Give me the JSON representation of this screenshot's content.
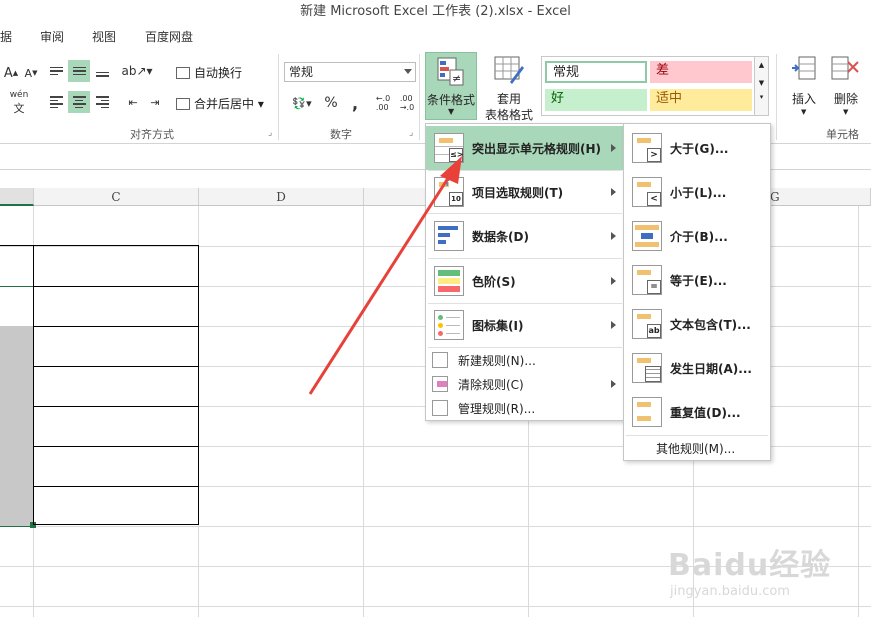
{
  "window": {
    "title": "新建 Microsoft Excel 工作表 (2).xlsx - Excel"
  },
  "ribbon_tabs": [
    "据",
    "审阅",
    "视图",
    "百度网盘"
  ],
  "ribbon": {
    "font_grow": "A",
    "font_shrink": "A",
    "phonetic": "wén",
    "wrap_text": "自动换行",
    "merge_center": "合并后居中",
    "alignment_group": "对齐方式",
    "number_format_value": "常规",
    "percent": "%",
    "comma": ",",
    "number_group": "数字",
    "conditional_format": "条件格式",
    "table_format_line1": "套用",
    "table_format_line2": "表格格式",
    "styles": {
      "normal": "常规",
      "bad": "差",
      "good": "好",
      "neutral": "适中"
    },
    "insert": "插入",
    "delete": "删除",
    "cells_group": "单元格"
  },
  "columns": [
    "C",
    "D",
    "G"
  ],
  "cf_menu": {
    "items": [
      {
        "label": "突出显示单元格规则(H)",
        "icon": "highlight-cells-icon"
      },
      {
        "label": "项目选取规则(T)",
        "icon": "top-bottom-icon"
      },
      {
        "label": "数据条(D)",
        "icon": "data-bars-icon"
      },
      {
        "label": "色阶(S)",
        "icon": "color-scales-icon"
      },
      {
        "label": "图标集(I)",
        "icon": "icon-sets-icon"
      }
    ],
    "small_items": [
      {
        "label": "新建规则(N)...",
        "icon": "new-rule-icon"
      },
      {
        "label": "清除规则(C)",
        "icon": "clear-rules-icon"
      },
      {
        "label": "管理规则(R)...",
        "icon": "manage-rules-icon"
      }
    ]
  },
  "submenu": {
    "items": [
      {
        "label": "大于(G)...",
        "icon": "greater-than-icon"
      },
      {
        "label": "小于(L)...",
        "icon": "less-than-icon"
      },
      {
        "label": "介于(B)...",
        "icon": "between-icon"
      },
      {
        "label": "等于(E)...",
        "icon": "equal-to-icon"
      },
      {
        "label": "文本包含(T)...",
        "icon": "text-contains-icon"
      },
      {
        "label": "发生日期(A)...",
        "icon": "date-occurring-icon"
      },
      {
        "label": "重复值(D)...",
        "icon": "duplicate-values-icon"
      }
    ],
    "more": "其他规则(M)..."
  },
  "watermark": {
    "brand": "Baidu经验",
    "url": "jingyan.baidu.com"
  },
  "colors": {
    "highlight": "#a9d7b9",
    "arrow": "#e8413a",
    "bad_bg": "#ffc7ce",
    "good_bg": "#c6efce",
    "neutral_bg": "#ffeb9c"
  }
}
